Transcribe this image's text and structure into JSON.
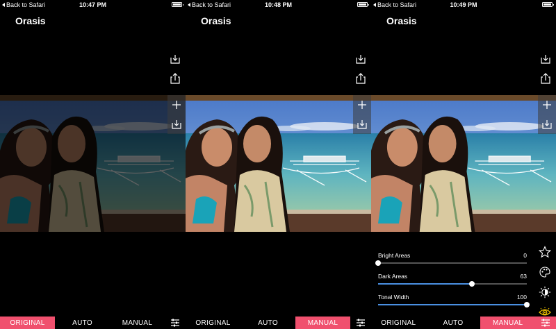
{
  "panels": [
    {
      "status": {
        "back": "Back to Safari",
        "time": "10:47 PM"
      },
      "title": "Orasis",
      "modes": {
        "original": "ORIGINAL",
        "auto": "AUTO",
        "manual": "MANUAL"
      },
      "active_mode": "original"
    },
    {
      "status": {
        "back": "Back to Safari",
        "time": "10:48 PM"
      },
      "title": "Orasis",
      "modes": {
        "original": "ORIGINAL",
        "auto": "AUTO",
        "manual": "MANUAL"
      },
      "active_mode": "manual"
    },
    {
      "status": {
        "back": "Back to Safari",
        "time": "10:49 PM"
      },
      "title": "Orasis",
      "modes": {
        "original": "ORIGINAL",
        "auto": "AUTO",
        "manual": "MANUAL"
      },
      "active_mode": "manual",
      "sliders": [
        {
          "label": "Bright Areas",
          "value": "0",
          "fraction": 0.0
        },
        {
          "label": "Dark Areas",
          "value": "63",
          "fraction": 0.63
        },
        {
          "label": "Tonal Width",
          "value": "100",
          "fraction": 1.0
        }
      ]
    }
  ],
  "icons": {
    "top_tools": [
      "save-icon",
      "share-icon"
    ],
    "overlay_tools": [
      "plus-icon",
      "import-icon"
    ],
    "bottom_tool": "sliders-icon",
    "right_tools": [
      "star-icon",
      "palette-icon",
      "brightness-icon",
      "eye-icon"
    ]
  },
  "colors": {
    "accent": "#f0506e",
    "slider_fill": "#4a90e2",
    "background": "#000000"
  }
}
